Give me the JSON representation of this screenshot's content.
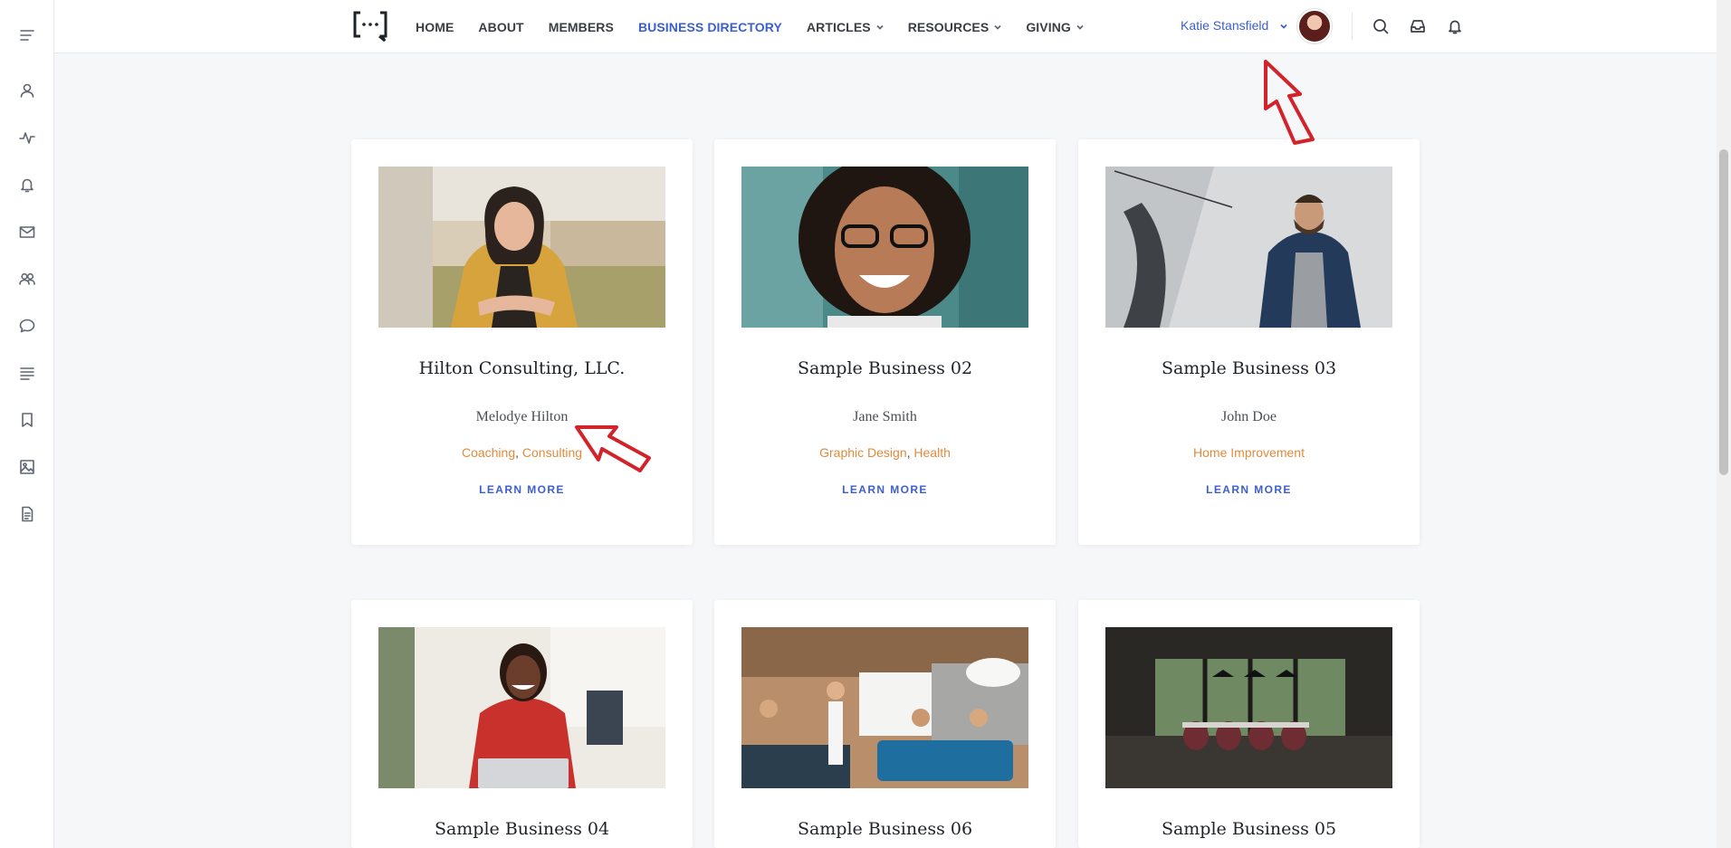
{
  "sidebar": {
    "items": [
      {
        "icon": "menu-icon"
      },
      {
        "icon": "user-icon"
      },
      {
        "icon": "activity-icon"
      },
      {
        "icon": "bell-icon"
      },
      {
        "icon": "mail-icon"
      },
      {
        "icon": "users-icon"
      },
      {
        "icon": "chat-icon"
      },
      {
        "icon": "list-icon"
      },
      {
        "icon": "bookmark-icon"
      },
      {
        "icon": "image-icon"
      },
      {
        "icon": "document-icon"
      }
    ]
  },
  "header": {
    "nav": [
      {
        "label": "HOME"
      },
      {
        "label": "ABOUT"
      },
      {
        "label": "MEMBERS"
      },
      {
        "label": "BUSINESS DIRECTORY"
      },
      {
        "label": "ARTICLES"
      },
      {
        "label": "RESOURCES"
      },
      {
        "label": "GIVING"
      }
    ],
    "user_name": "Katie Stansfield",
    "accent_color": "#3c5fcf"
  },
  "cards": [
    {
      "title": "Hilton Consulting, LLC.",
      "owner": "Melodye Hilton",
      "cat1": "Coaching",
      "cat2": "Consulting",
      "link": "LEARN MORE"
    },
    {
      "title": "Sample Business 02",
      "owner": "Jane Smith",
      "cat1": "Graphic Design",
      "cat2": "Health",
      "link": "LEARN MORE"
    },
    {
      "title": "Sample Business 03",
      "owner": "John Doe",
      "cat1": "Home Improvement",
      "link": "LEARN MORE"
    },
    {
      "title": "Sample Business 04"
    },
    {
      "title": "Sample Business 06"
    },
    {
      "title": "Sample Business 05"
    }
  ],
  "category_color": "#e28a3b"
}
